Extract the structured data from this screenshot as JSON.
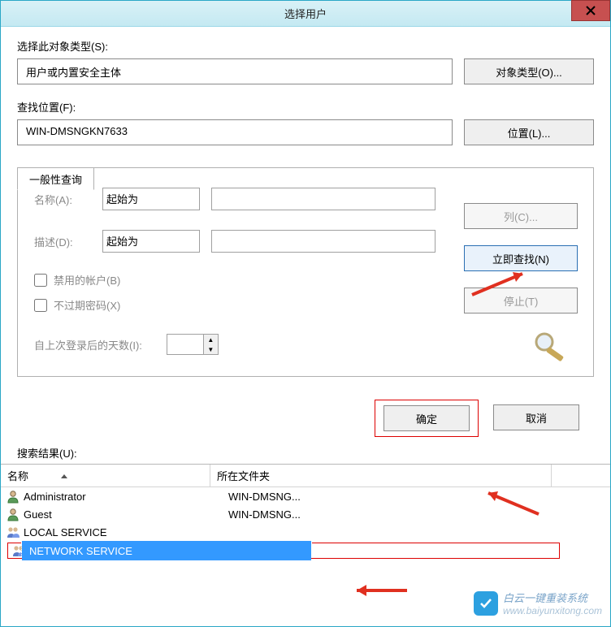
{
  "title": "选择用户",
  "section1": {
    "label": "选择此对象类型(S):",
    "value": "用户或内置安全主体",
    "btn": "对象类型(O)..."
  },
  "section2": {
    "label": "查找位置(F):",
    "value": "WIN-DMSNGKN7633",
    "btn": "位置(L)..."
  },
  "tab": "一般性查询",
  "query": {
    "name_label": "名称(A):",
    "name_op": "起始为",
    "desc_label": "描述(D):",
    "desc_op": "起始为",
    "disabled": "禁用的帐户(B)",
    "noexpire": "不过期密码(X)",
    "days_label": "自上次登录后的天数(I):"
  },
  "side": {
    "columns": "列(C)...",
    "find": "立即查找(N)",
    "stop": "停止(T)"
  },
  "actions": {
    "ok": "确定",
    "cancel": "取消"
  },
  "results_label": "搜索结果(U):",
  "cols": {
    "name": "名称",
    "folder": "所在文件夹"
  },
  "rows": [
    {
      "name": "Administrator",
      "folder": "WIN-DMSNG...",
      "selected": false
    },
    {
      "name": "Guest",
      "folder": "WIN-DMSNG...",
      "selected": false
    },
    {
      "name": "LOCAL SERVICE",
      "folder": "",
      "selected": false
    },
    {
      "name": "NETWORK SERVICE",
      "folder": "",
      "selected": true
    }
  ],
  "watermark": {
    "main": "白云一键重装系统",
    "sub": "www.baiyunxitong.com"
  }
}
